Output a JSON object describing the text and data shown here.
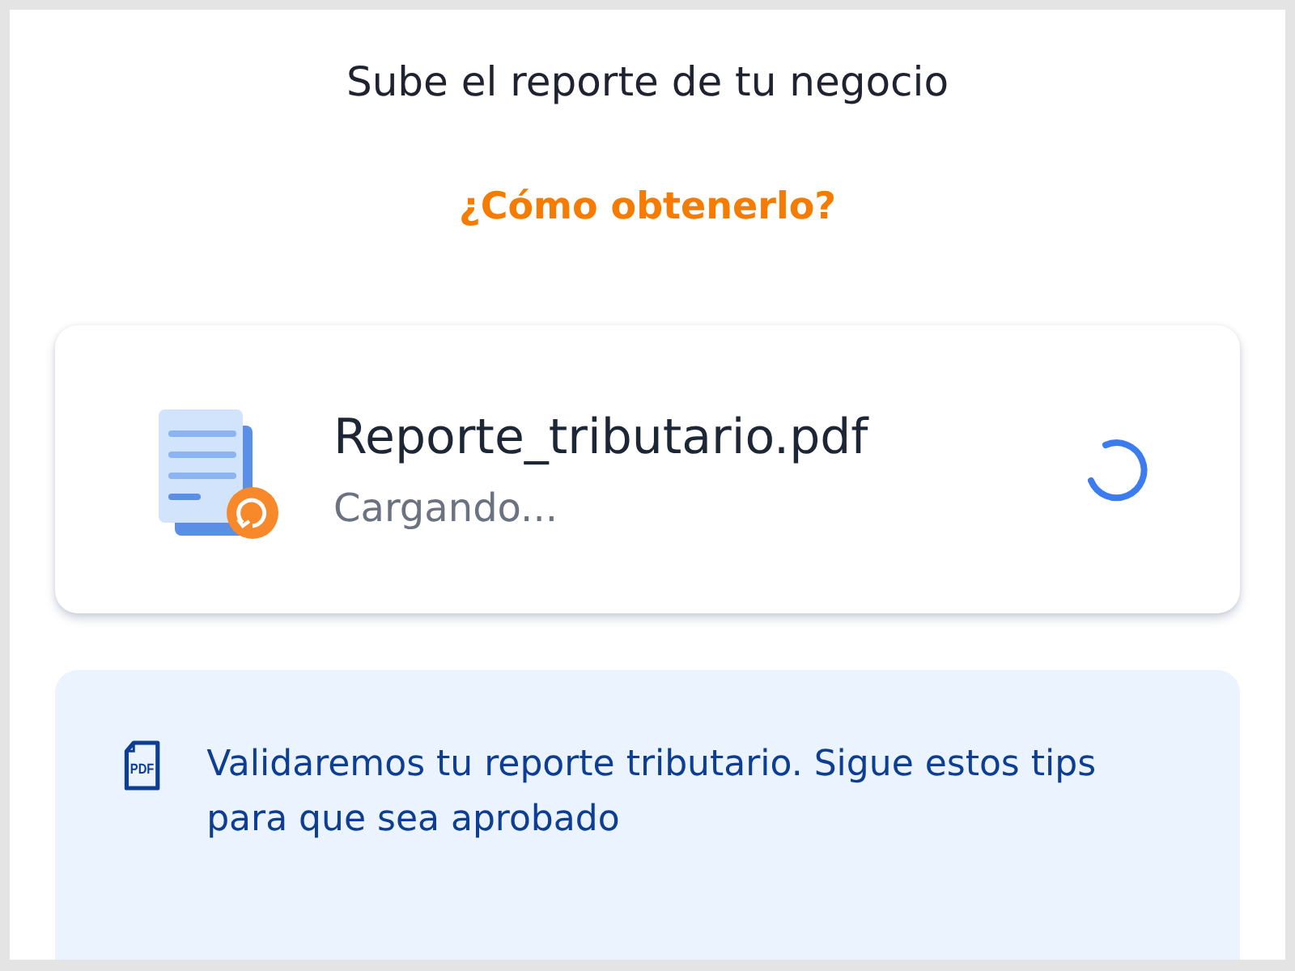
{
  "header": {
    "title": "Sube el reporte de tu negocio",
    "help_link": "¿Cómo obtenerlo?"
  },
  "upload": {
    "file_name": "Reporte_tributario.pdf",
    "status_text": "Cargando...",
    "loading": true
  },
  "info": {
    "icon_label": "PDF",
    "message": "Validaremos tu reporte tributario. Sigue estos tips para que sea aprobado"
  }
}
